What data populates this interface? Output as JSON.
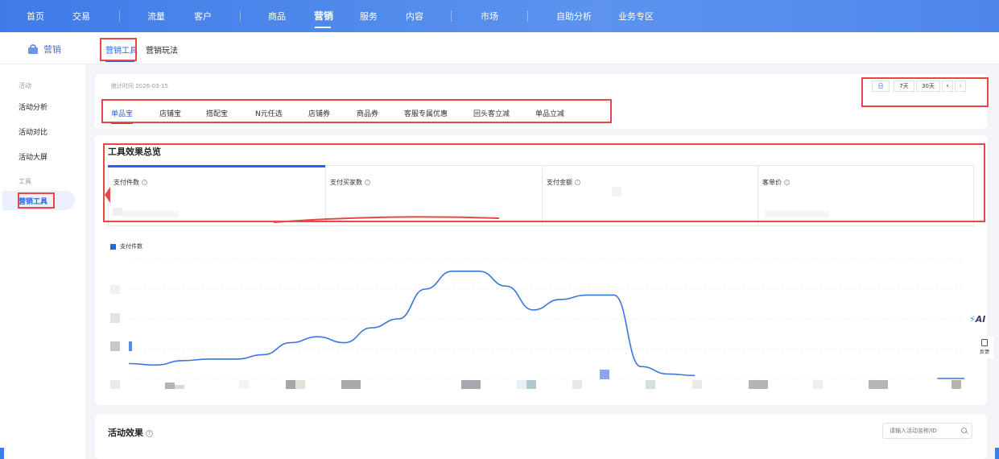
{
  "topnav": {
    "items": [
      "首页",
      "交易",
      "流量",
      "客户",
      "商品",
      "营销",
      "服务",
      "内容",
      "市场",
      "自助分析",
      "业务专区"
    ],
    "active": "营销"
  },
  "subheader": {
    "brand": "营销",
    "tabs": [
      "营销工具",
      "营销玩法"
    ]
  },
  "sidebar": {
    "group1": "活动",
    "items1": [
      "活动分析",
      "活动对比",
      "活动大屏"
    ],
    "group2": "工具",
    "items2": [
      "营销工具"
    ]
  },
  "stats": {
    "time_label": "统计时间 2026-03-15"
  },
  "date_controls": [
    "日",
    "7天",
    "30天",
    "‹",
    "›"
  ],
  "tool_tabs": [
    "单品宝",
    "店铺宝",
    "搭配宝",
    "N元任选",
    "店铺券",
    "商品券",
    "客服专属优惠",
    "回头客立减",
    "单品立减"
  ],
  "overview": {
    "title": "工具效果总览",
    "metrics": [
      "支付件数",
      "支付买家数",
      "支付金额",
      "客单价"
    ]
  },
  "chart_data": {
    "type": "line",
    "series": [
      {
        "name": "支付件数",
        "values": [
          10,
          9,
          12,
          13,
          13,
          16,
          24,
          28,
          24,
          34,
          40,
          60,
          72,
          72,
          62,
          46,
          53,
          56,
          56,
          8,
          3,
          2,
          null,
          null,
          null,
          null,
          null,
          null,
          null,
          null,
          0,
          0
        ]
      }
    ],
    "y_scale": "hidden (pixelated)",
    "x_labels": "hidden (pixelated)",
    "color": "#3b75de"
  },
  "activity": {
    "title": "活动效果",
    "search_placeholder": "请输入活动名称/ID"
  },
  "floats": {
    "ai": "AI",
    "feedback": "反馈"
  }
}
